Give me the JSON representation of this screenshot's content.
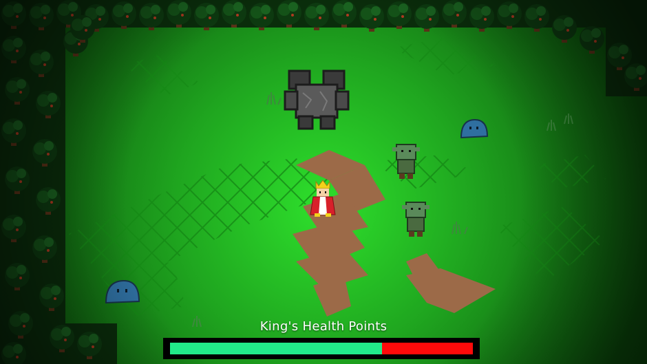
{
  "hud": {
    "health_title": "King's Health Points",
    "health_fraction": 0.7,
    "health_fill_color": "#22ea8a",
    "health_missing_color": "#ff0a0a"
  },
  "scene": {
    "ground_color": "#1fa51f",
    "path_color": "#9c6a48",
    "forest_color": "#0e3d0f",
    "entities": [
      {
        "name": "king",
        "icon": "crowned-king-icon"
      },
      {
        "name": "stone-golem",
        "icon": "golem-icon"
      },
      {
        "name": "orc",
        "icon": "orc-icon"
      },
      {
        "name": "orc",
        "icon": "orc-icon"
      },
      {
        "name": "slime",
        "icon": "slime-icon"
      },
      {
        "name": "slime",
        "icon": "slime-icon"
      }
    ]
  }
}
